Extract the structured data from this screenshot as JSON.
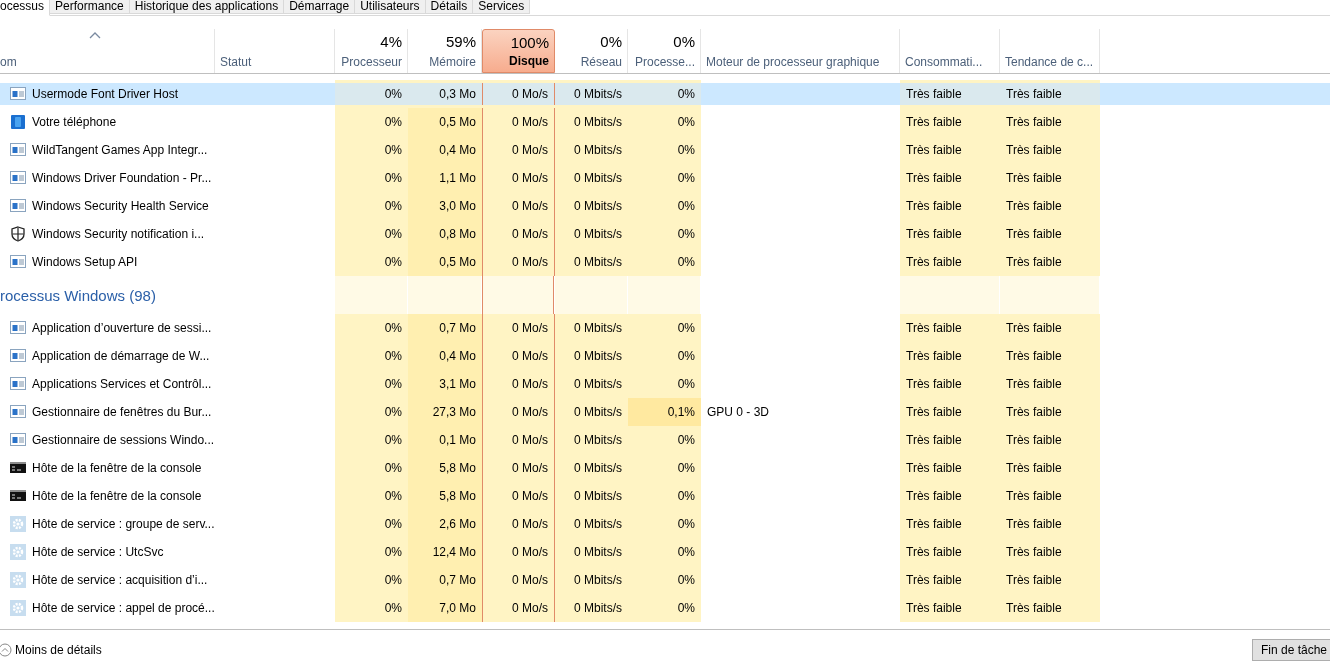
{
  "tabs": [
    {
      "label": "ocessus",
      "selected": true
    },
    {
      "label": "Performance",
      "selected": false
    },
    {
      "label": "Historique des applications",
      "selected": false
    },
    {
      "label": "Démarrage",
      "selected": false
    },
    {
      "label": "Utilisateurs",
      "selected": false
    },
    {
      "label": "Détails",
      "selected": false
    },
    {
      "label": "Services",
      "selected": false
    }
  ],
  "columns": [
    {
      "label": "om",
      "sorted": true
    },
    {
      "label": "Statut"
    },
    {
      "total": "4%",
      "label": "Processeur",
      "critical": false
    },
    {
      "total": "59%",
      "label": "Mémoire",
      "critical": false
    },
    {
      "total": "100%",
      "label": "Disque",
      "critical": true
    },
    {
      "total": "0%",
      "label": "Réseau",
      "critical": false
    },
    {
      "total": "0%",
      "label": "Processe...",
      "critical": false
    },
    {
      "label": "Moteur de processeur graphique"
    },
    {
      "label": "Consommati..."
    },
    {
      "label": "Tendance de c..."
    }
  ],
  "rows": [
    {
      "kind": "window",
      "name": "Usermode Font Driver Host",
      "cpu": "0%",
      "memory": "0,3 Mo",
      "disk": "0 Mo/s",
      "network": "0 Mbits/s",
      "gpu": "0%",
      "power": "Très faible",
      "power_trend": "Très faible",
      "selected": true
    },
    {
      "kind": "tile",
      "name": "Votre téléphone",
      "cpu": "0%",
      "memory": "0,5 Mo",
      "disk": "0 Mo/s",
      "network": "0 Mbits/s",
      "gpu": "0%",
      "power": "Très faible",
      "power_trend": "Très faible",
      "selected": false
    },
    {
      "kind": "window",
      "name": "WildTangent Games App Integr...",
      "cpu": "0%",
      "memory": "0,4 Mo",
      "disk": "0 Mo/s",
      "network": "0 Mbits/s",
      "gpu": "0%",
      "power": "Très faible",
      "power_trend": "Très faible",
      "selected": false
    },
    {
      "kind": "window",
      "name": "Windows Driver Foundation - Pr...",
      "cpu": "0%",
      "memory": "1,1 Mo",
      "disk": "0 Mo/s",
      "network": "0 Mbits/s",
      "gpu": "0%",
      "power": "Très faible",
      "power_trend": "Très faible",
      "selected": false
    },
    {
      "kind": "window",
      "name": "Windows Security Health Service",
      "cpu": "0%",
      "memory": "3,0 Mo",
      "disk": "0 Mo/s",
      "network": "0 Mbits/s",
      "gpu": "0%",
      "power": "Très faible",
      "power_trend": "Très faible",
      "selected": false
    },
    {
      "kind": "shield",
      "name": "Windows Security notification i...",
      "cpu": "0%",
      "memory": "0,8 Mo",
      "disk": "0 Mo/s",
      "network": "0 Mbits/s",
      "gpu": "0%",
      "power": "Très faible",
      "power_trend": "Très faible",
      "selected": false
    },
    {
      "kind": "window",
      "name": "Windows Setup API",
      "cpu": "0%",
      "memory": "0,5 Mo",
      "disk": "0 Mo/s",
      "network": "0 Mbits/s",
      "gpu": "0%",
      "power": "Très faible",
      "power_trend": "Très faible",
      "selected": false
    },
    {
      "kind": "group",
      "name": "rocessus Windows (98)"
    },
    {
      "kind": "window",
      "name": "Application d’ouverture de sessi...",
      "cpu": "0%",
      "memory": "0,7 Mo",
      "disk": "0 Mo/s",
      "network": "0 Mbits/s",
      "gpu": "0%",
      "power": "Très faible",
      "power_trend": "Très faible",
      "selected": false
    },
    {
      "kind": "window",
      "name": "Application de démarrage de W...",
      "cpu": "0%",
      "memory": "0,4 Mo",
      "disk": "0 Mo/s",
      "network": "0 Mbits/s",
      "gpu": "0%",
      "power": "Très faible",
      "power_trend": "Très faible",
      "selected": false
    },
    {
      "kind": "window",
      "name": "Applications Services et Contrôl...",
      "cpu": "0%",
      "memory": "3,1 Mo",
      "disk": "0 Mo/s",
      "network": "0 Mbits/s",
      "gpu": "0%",
      "power": "Très faible",
      "power_trend": "Très faible",
      "selected": false
    },
    {
      "kind": "window",
      "name": "Gestionnaire de fenêtres du Bur...",
      "cpu": "0%",
      "memory": "27,3 Mo",
      "disk": "0 Mo/s",
      "network": "0 Mbits/s",
      "gpu": "0,1%",
      "gpu_engine": "GPU 0 - 3D",
      "power": "Très faible",
      "power_trend": "Très faible",
      "selected": false
    },
    {
      "kind": "window",
      "name": "Gestionnaire de sessions Windo...",
      "cpu": "0%",
      "memory": "0,1 Mo",
      "disk": "0 Mo/s",
      "network": "0 Mbits/s",
      "gpu": "0%",
      "power": "Très faible",
      "power_trend": "Très faible",
      "selected": false
    },
    {
      "kind": "console",
      "name": "Hôte de la fenêtre de la console",
      "cpu": "0%",
      "memory": "5,8 Mo",
      "disk": "0 Mo/s",
      "network": "0 Mbits/s",
      "gpu": "0%",
      "power": "Très faible",
      "power_trend": "Très faible",
      "selected": false
    },
    {
      "kind": "console",
      "name": "Hôte de la fenêtre de la console",
      "cpu": "0%",
      "memory": "5,8 Mo",
      "disk": "0 Mo/s",
      "network": "0 Mbits/s",
      "gpu": "0%",
      "power": "Très faible",
      "power_trend": "Très faible",
      "selected": false
    },
    {
      "kind": "gear",
      "name": "Hôte de service : groupe de serv...",
      "cpu": "0%",
      "memory": "2,6 Mo",
      "disk": "0 Mo/s",
      "network": "0 Mbits/s",
      "gpu": "0%",
      "power": "Très faible",
      "power_trend": "Très faible",
      "selected": false
    },
    {
      "kind": "gear",
      "name": "Hôte de service : UtcSvc",
      "cpu": "0%",
      "memory": "12,4 Mo",
      "disk": "0 Mo/s",
      "network": "0 Mbits/s",
      "gpu": "0%",
      "power": "Très faible",
      "power_trend": "Très faible",
      "selected": false
    },
    {
      "kind": "gear",
      "name": "Hôte de service : acquisition d’i...",
      "cpu": "0%",
      "memory": "0,7 Mo",
      "disk": "0 Mo/s",
      "network": "0 Mbits/s",
      "gpu": "0%",
      "power": "Très faible",
      "power_trend": "Très faible",
      "selected": false
    },
    {
      "kind": "gear",
      "name": "Hôte de service : appel de procé...",
      "cpu": "0%",
      "memory": "7,0 Mo",
      "disk": "0 Mo/s",
      "network": "0 Mbits/s",
      "gpu": "0%",
      "power": "Très faible",
      "power_trend": "Très faible",
      "selected": false
    }
  ],
  "footer": {
    "details_link": "Moins de détails",
    "end_task_button": "Fin de tâche"
  }
}
